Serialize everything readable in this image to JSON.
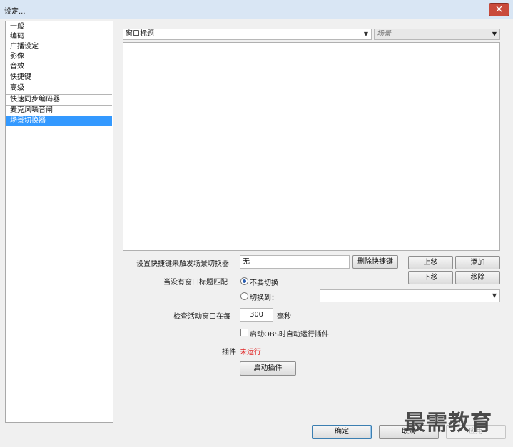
{
  "window": {
    "title": "设定...",
    "close_icon": "×"
  },
  "sidebar": {
    "items": [
      {
        "label": "一般"
      },
      {
        "label": "编码"
      },
      {
        "label": "广播设定"
      },
      {
        "label": "影像"
      },
      {
        "label": "音效"
      },
      {
        "label": "快捷键"
      },
      {
        "label": "高级"
      },
      {
        "label": "快速同步编码器"
      },
      {
        "label": "麦克风噪音闸"
      },
      {
        "label": "场景切换器"
      }
    ],
    "selected": "场景切换器",
    "selected_color": "#3399ff"
  },
  "main": {
    "window_title_combo": "窗口标题",
    "scene_combo": "场景",
    "hotkey_label": "设置快捷键来触发场景切换器",
    "hotkey_value": "无",
    "delete_hotkey_button": "删除快捷键",
    "move_up_button": "上移",
    "add_button": "添加",
    "move_down_button": "下移",
    "remove_button": "移除",
    "no_match_label": "当没有窗口标题匹配",
    "radio_no_switch": "不要切换",
    "radio_switch_to": "切换到：",
    "switch_to_value": "",
    "check_interval_label": "检查活动窗口在每",
    "check_interval_value": "300",
    "check_interval_unit": "毫秒",
    "autostart_label": "启动OBS时自动运行插件",
    "plugin_label": "插件",
    "plugin_status": "未运行",
    "plugin_status_color": "#e02020",
    "start_plugin_button": "启动插件"
  },
  "footer": {
    "ok_button": "确定",
    "cancel_button": "取消",
    "apply_button": "应用"
  },
  "watermark": "最需教育"
}
